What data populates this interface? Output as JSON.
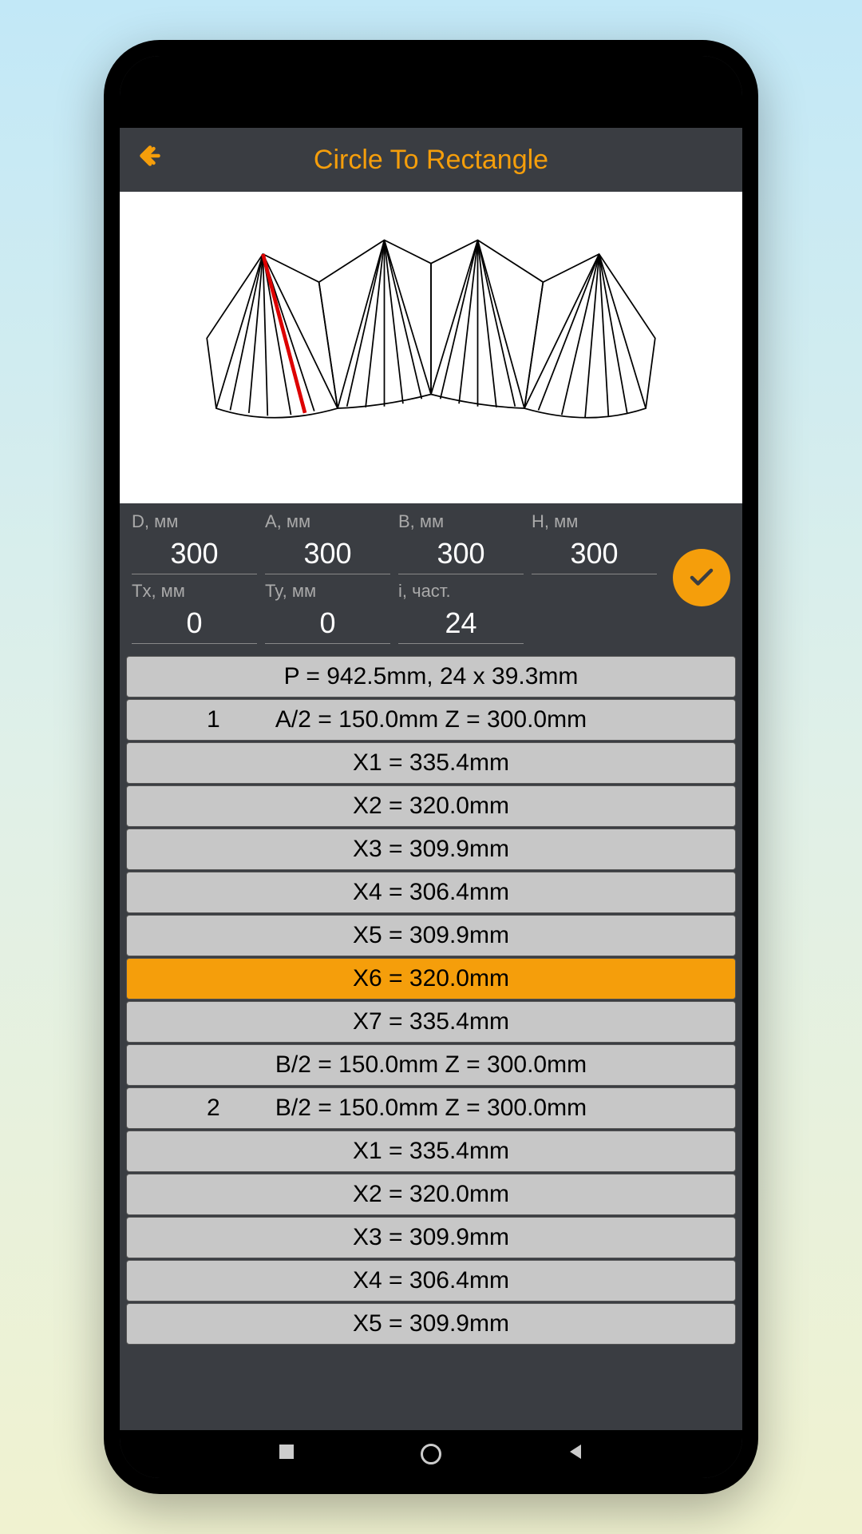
{
  "header": {
    "title": "Circle To Rectangle"
  },
  "inputs": {
    "d": {
      "label": "D, мм",
      "value": "300"
    },
    "a": {
      "label": "A, мм",
      "value": "300"
    },
    "b": {
      "label": "B, мм",
      "value": "300"
    },
    "h": {
      "label": "H, мм",
      "value": "300"
    },
    "tx": {
      "label": "Tx, мм",
      "value": "0"
    },
    "ty": {
      "label": "Ty, мм",
      "value": "0"
    },
    "i": {
      "label": "i, част.",
      "value": "24"
    }
  },
  "results": [
    {
      "text": "P = 942.5mm,   24 x 39.3mm",
      "highlighted": false,
      "index": ""
    },
    {
      "text": "A/2 = 150.0mm     Z = 300.0mm",
      "highlighted": false,
      "index": "1"
    },
    {
      "text": "X1 = 335.4mm",
      "highlighted": false,
      "index": ""
    },
    {
      "text": "X2 = 320.0mm",
      "highlighted": false,
      "index": ""
    },
    {
      "text": "X3 = 309.9mm",
      "highlighted": false,
      "index": ""
    },
    {
      "text": "X4 = 306.4mm",
      "highlighted": false,
      "index": ""
    },
    {
      "text": "X5 = 309.9mm",
      "highlighted": false,
      "index": ""
    },
    {
      "text": "X6 = 320.0mm",
      "highlighted": true,
      "index": ""
    },
    {
      "text": "X7 = 335.4mm",
      "highlighted": false,
      "index": ""
    },
    {
      "text": "B/2 = 150.0mm     Z = 300.0mm",
      "highlighted": false,
      "index": ""
    },
    {
      "text": "B/2 = 150.0mm     Z = 300.0mm",
      "highlighted": false,
      "index": "2"
    },
    {
      "text": "X1 = 335.4mm",
      "highlighted": false,
      "index": ""
    },
    {
      "text": "X2 = 320.0mm",
      "highlighted": false,
      "index": ""
    },
    {
      "text": "X3 = 309.9mm",
      "highlighted": false,
      "index": ""
    },
    {
      "text": "X4 = 306.4mm",
      "highlighted": false,
      "index": ""
    },
    {
      "text": "X5 = 309.9mm",
      "highlighted": false,
      "index": ""
    }
  ]
}
